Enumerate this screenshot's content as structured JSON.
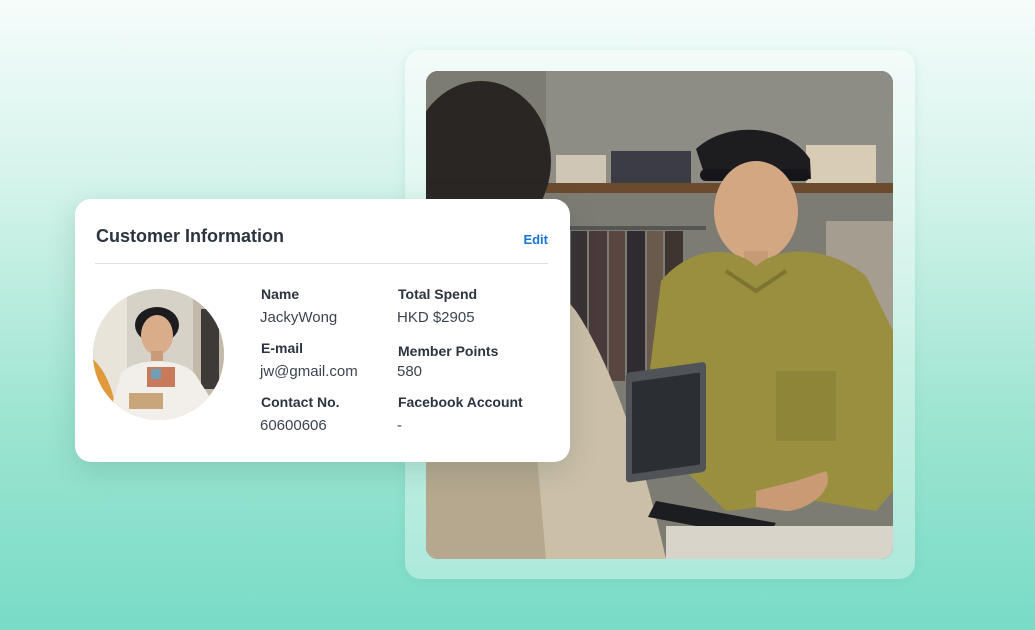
{
  "card": {
    "title": "Customer Information",
    "edit_label": "Edit"
  },
  "customer": {
    "name_label": "Name",
    "name_value": "JackyWong",
    "email_label": "E-mail",
    "email_value": "jw@gmail.com",
    "contact_label": "Contact No.",
    "contact_value": "60600606",
    "total_spend_label": "Total Spend",
    "total_spend_value": "HKD $2905",
    "member_points_label": "Member Points",
    "member_points_value": "580",
    "facebook_label": "Facebook Account",
    "facebook_value": "-"
  },
  "colors": {
    "accent": "#1a73d9",
    "background_top": "#f6fcfb",
    "background_bottom": "#78dcc6"
  }
}
